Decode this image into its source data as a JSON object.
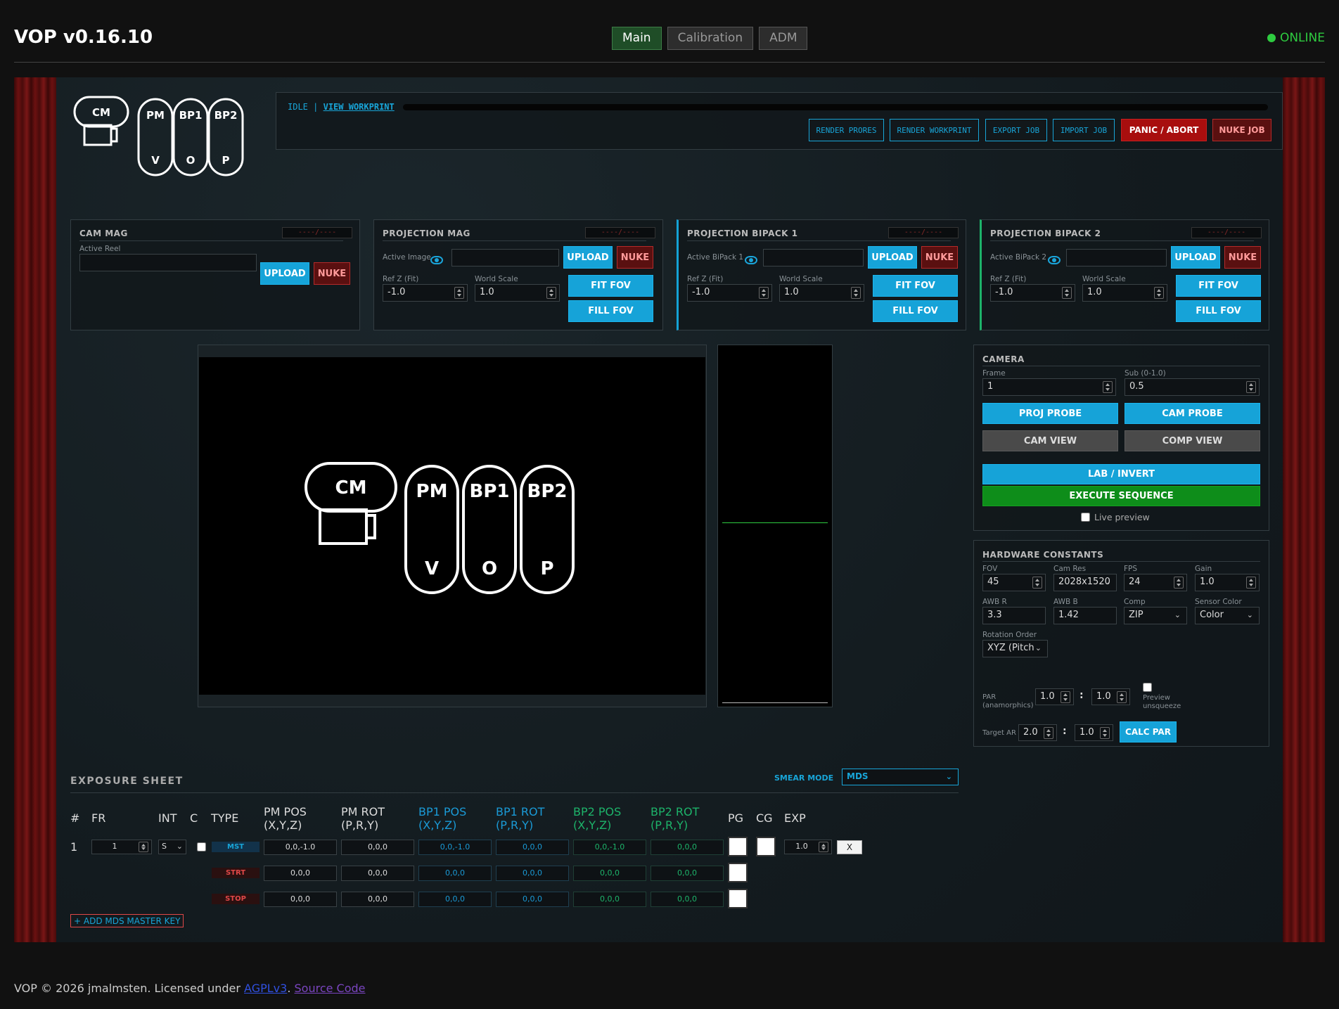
{
  "header": {
    "title": "VOP v0.16.10",
    "tabs": [
      "Main",
      "Calibration",
      "ADM"
    ],
    "status": "ONLINE"
  },
  "logo": {
    "cm": "CM",
    "pm": "PM",
    "bp1": "BP1",
    "bp2": "BP2",
    "v": "V",
    "o": "O",
    "p": "P"
  },
  "topbar": {
    "status": "IDLE",
    "separator": "|",
    "link": "VIEW WORKPRINT",
    "buttons": {
      "render_prores": "RENDER PRORES",
      "render_workprint": "RENDER WORKPRINT",
      "export_job": "EXPORT JOB",
      "import_job": "IMPORT JOB",
      "panic": "PANIC / ABORT",
      "nuke_job": "NUKE JOB"
    }
  },
  "mags": {
    "meter": "----/----",
    "cam": {
      "title": "CAM MAG",
      "active_label": "Active Reel",
      "upload": "UPLOAD",
      "nuke": "NUKE"
    },
    "proj": {
      "title": "PROJECTION MAG",
      "active_label": "Active Image",
      "upload": "UPLOAD",
      "nuke": "NUKE",
      "refz_label": "Ref Z (Fit)",
      "refz": "-1.0",
      "scale_label": "World Scale",
      "scale": "1.0",
      "fit": "FIT FOV",
      "fill": "FILL FOV"
    },
    "bp1": {
      "title": "PROJECTION BIPACK 1",
      "active_label": "Active BiPack 1",
      "upload": "UPLOAD",
      "nuke": "NUKE",
      "refz_label": "Ref Z (Fit)",
      "refz": "-1.0",
      "scale_label": "World Scale",
      "scale": "1.0",
      "fit": "FIT FOV",
      "fill": "FILL FOV"
    },
    "bp2": {
      "title": "PROJECTION BIPACK 2",
      "active_label": "Active BiPack 2",
      "upload": "UPLOAD",
      "nuke": "NUKE",
      "refz_label": "Ref Z (Fit)",
      "refz": "-1.0",
      "scale_label": "World Scale",
      "scale": "1.0",
      "fit": "FIT FOV",
      "fill": "FILL FOV"
    }
  },
  "camera": {
    "title": "CAMERA",
    "frame_label": "Frame",
    "frame": "1",
    "sub_label": "Sub (0-1.0)",
    "sub": "0.5",
    "proj_probe": "PROJ PROBE",
    "cam_probe": "CAM PROBE",
    "cam_view": "CAM VIEW",
    "comp_view": "COMP VIEW",
    "lab_invert": "LAB / INVERT",
    "execute": "EXECUTE SEQUENCE",
    "live_preview": "Live preview"
  },
  "hardware": {
    "title": "HARDWARE CONSTANTS",
    "fov_label": "FOV",
    "fov": "45",
    "camres_label": "Cam Res",
    "camres": "2028x1520",
    "fps_label": "FPS",
    "fps": "24",
    "gain_label": "Gain",
    "gain": "1.0",
    "awbr_label": "AWB R",
    "awbr": "3.3",
    "awbb_label": "AWB B",
    "awbb": "1.42",
    "comp_label": "Comp",
    "comp": "ZIP",
    "sensor_label": "Sensor Color",
    "sensor": "Color",
    "rot_label": "Rotation Order",
    "rot": "XYZ (Pitch",
    "par_label": "PAR",
    "par_sub": "(anamorphics)",
    "par_a": "1.0",
    "par_b": "1.0",
    "colon": ":",
    "preview_unsq_1": "Preview",
    "preview_unsq_2": "unsqueeze",
    "target_label": "Target AR",
    "target_a": "2.0",
    "target_b": "1.0",
    "calc_par": "CALC PAR"
  },
  "exposure": {
    "title": "EXPOSURE SHEET",
    "smear_label": "SMEAR MODE",
    "smear_value": "MDS",
    "headers": {
      "num": "#",
      "fr": "FR",
      "int": "INT",
      "c": "C",
      "type": "TYPE",
      "pm_pos_1": "PM POS",
      "pm_pos_2": "(X,Y,Z)",
      "pm_rot_1": "PM ROT",
      "pm_rot_2": "(P,R,Y)",
      "bp1_pos_1": "BP1 POS",
      "bp1_pos_2": "(X,Y,Z)",
      "bp1_rot_1": "BP1 ROT",
      "bp1_rot_2": "(P,R,Y)",
      "bp2_pos_1": "BP2 POS",
      "bp2_pos_2": "(X,Y,Z)",
      "bp2_rot_1": "BP2 ROT",
      "bp2_rot_2": "(P,R,Y)",
      "pg": "PG",
      "cg": "CG",
      "exp": "EXP"
    },
    "row": {
      "num": "1",
      "fr": "1",
      "int": "S",
      "exp": "1.0",
      "remove": "X",
      "mst": {
        "type": "MST",
        "pm_pos": "0,0,-1.0",
        "pm_rot": "0,0,0",
        "bp1_pos": "0,0,-1.0",
        "bp1_rot": "0,0,0",
        "bp2_pos": "0,0,-1.0",
        "bp2_rot": "0,0,0"
      },
      "strt": {
        "type": "STRT",
        "pm_pos": "0,0,0",
        "pm_rot": "0,0,0",
        "bp1_pos": "0,0,0",
        "bp1_rot": "0,0,0",
        "bp2_pos": "0,0,0",
        "bp2_rot": "0,0,0"
      },
      "stop": {
        "type": "STOP",
        "pm_pos": "0,0,0",
        "pm_rot": "0,0,0",
        "bp1_pos": "0,0,0",
        "bp1_rot": "0,0,0",
        "bp2_pos": "0,0,0",
        "bp2_rot": "0,0,0"
      }
    },
    "add_master": "+ ADD MDS MASTER KEY"
  },
  "footer": {
    "text": "VOP © 2026 jmalmsten. Licensed under ",
    "license": "AGPLv3",
    "dot": ".",
    "source": "Source Code"
  }
}
